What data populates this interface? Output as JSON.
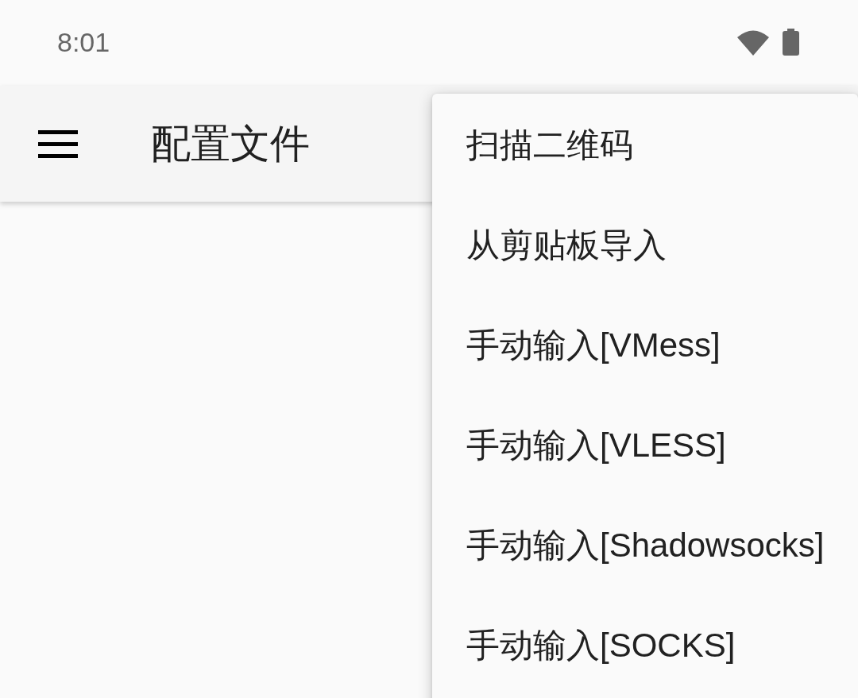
{
  "status_bar": {
    "time": "8:01"
  },
  "app_bar": {
    "title": "配置文件"
  },
  "menu": {
    "items": [
      {
        "label": "扫描二维码"
      },
      {
        "label": "从剪贴板导入"
      },
      {
        "label": "手动输入[VMess]"
      },
      {
        "label": "手动输入[VLESS]"
      },
      {
        "label": "手动输入[Shadowsocks]"
      },
      {
        "label": "手动输入[SOCKS]"
      }
    ]
  }
}
